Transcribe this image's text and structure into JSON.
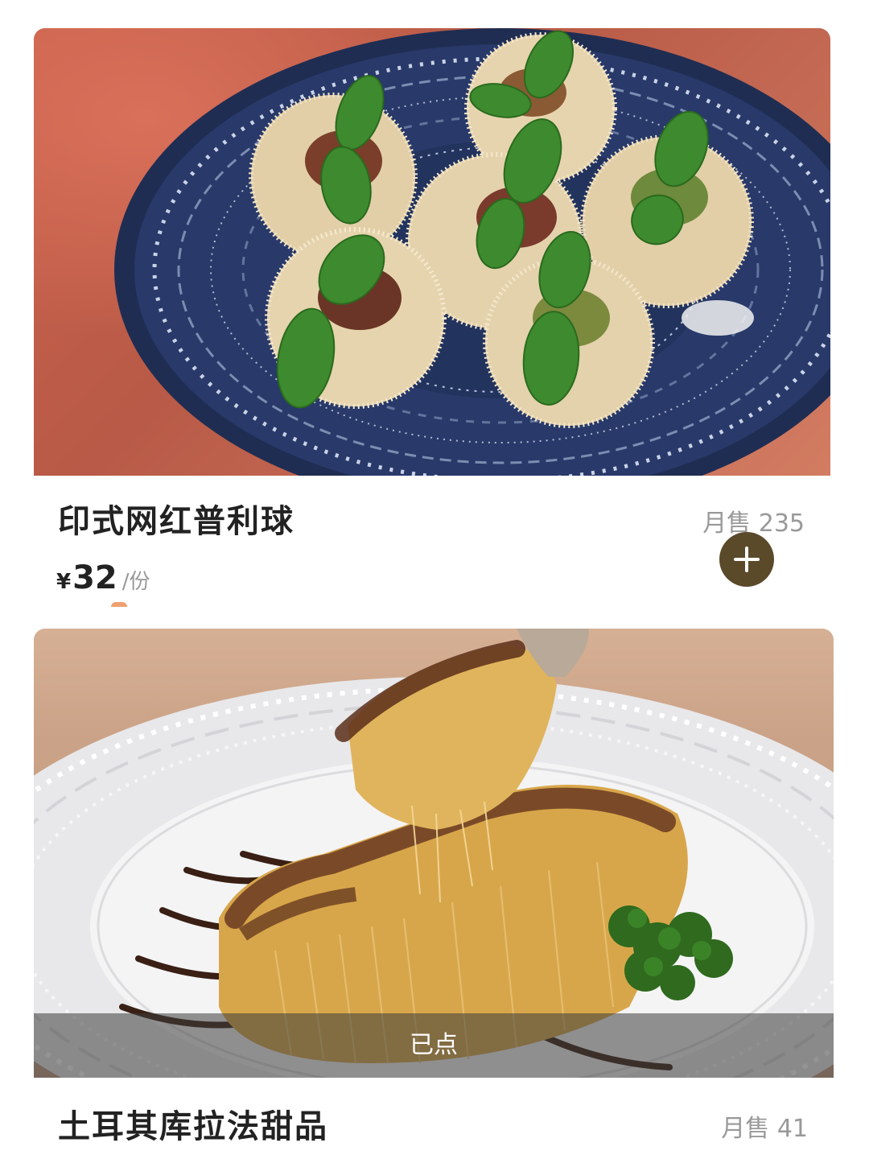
{
  "items": [
    {
      "name": "印式网红普利球",
      "sales_label": "月售",
      "sales_count": "235",
      "price_currency": "¥",
      "price_value": "32",
      "price_unit": "/份",
      "add_button_icon": "plus-icon",
      "image_desc": "pani-puri-photo"
    },
    {
      "name": "土耳其库拉法甜品",
      "sales_label": "月售",
      "sales_count": "41",
      "ordered_label": "已点",
      "image_desc": "kunafa-dessert-photo"
    }
  ],
  "colors": {
    "add_button": "#5a4a2a",
    "title_text": "#222222",
    "muted_text": "#999999",
    "accent_orange": "#f0a070"
  }
}
